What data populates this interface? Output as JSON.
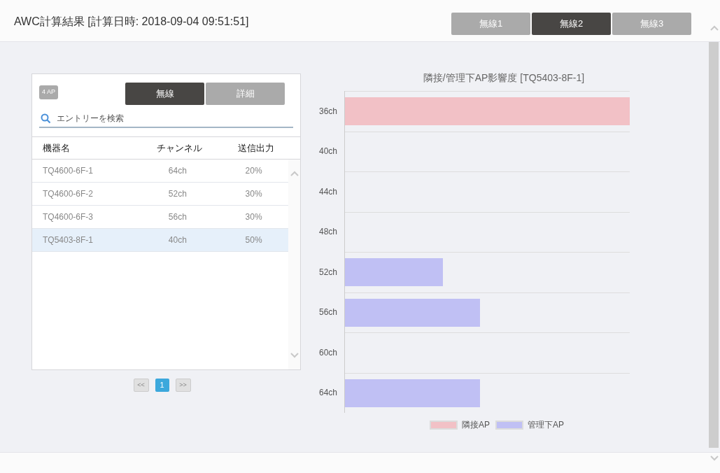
{
  "header": {
    "title": "AWC計算結果 [計算日時: 2018-09-04 09:51:51]"
  },
  "radio_tabs": [
    {
      "label": "無線1",
      "selected": false
    },
    {
      "label": "無線2",
      "selected": true
    },
    {
      "label": "無線3",
      "selected": false
    }
  ],
  "panel": {
    "badge": "4 AP",
    "tabs": [
      {
        "label": "無線",
        "selected": true
      },
      {
        "label": "詳細",
        "selected": false
      }
    ],
    "search": {
      "placeholder": "エントリーを検索"
    },
    "columns": [
      "機器名",
      "チャンネル",
      "送信出力"
    ],
    "rows": [
      {
        "cells": [
          "TQ4600-6F-1",
          "64ch",
          "20%"
        ],
        "selected": false
      },
      {
        "cells": [
          "TQ4600-6F-2",
          "52ch",
          "30%"
        ],
        "selected": false
      },
      {
        "cells": [
          "TQ4600-6F-3",
          "56ch",
          "30%"
        ],
        "selected": false
      },
      {
        "cells": [
          "TQ5403-8F-1",
          "40ch",
          "50%"
        ],
        "selected": true
      }
    ],
    "pagination": {
      "prev": "<<",
      "pages": [
        {
          "label": "1",
          "selected": true
        }
      ],
      "next": ">>"
    }
  },
  "chart": {
    "title": "隣接/管理下AP影響度 [TQ5403-8F-1]",
    "rows": [
      {
        "label": "36ch",
        "kind": "neighbor"
      },
      {
        "label": "40ch",
        "kind": "empty"
      },
      {
        "label": "44ch",
        "kind": "empty"
      },
      {
        "label": "48ch",
        "kind": "empty"
      },
      {
        "label": "52ch",
        "kind": "managed"
      },
      {
        "label": "56ch",
        "kind": "managed"
      },
      {
        "label": "60ch",
        "kind": "empty"
      },
      {
        "label": "64ch",
        "kind": "managed"
      }
    ],
    "legend": [
      {
        "label": "隣接AP",
        "kind": "neighbor",
        "color": "#f2c1c6"
      },
      {
        "label": "管理下AP",
        "kind": "managed",
        "color": "#c0c0f4"
      }
    ]
  }
}
